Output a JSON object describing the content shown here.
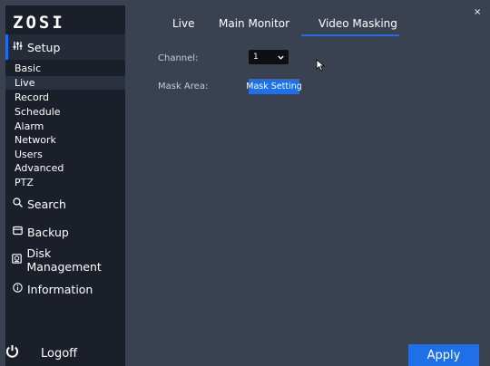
{
  "brand": {
    "logo": "ZOSI"
  },
  "sidebar": {
    "setup": {
      "label": "Setup",
      "icon": "sliders-icon"
    },
    "sub_items": [
      {
        "label": "Basic"
      },
      {
        "label": "Live"
      },
      {
        "label": "Record"
      },
      {
        "label": "Schedule"
      },
      {
        "label": "Alarm"
      },
      {
        "label": "Network"
      },
      {
        "label": "Users"
      },
      {
        "label": "Advanced"
      },
      {
        "label": "PTZ"
      }
    ],
    "active_sub": "Live",
    "search": {
      "label": "Search",
      "icon": "search-icon"
    },
    "backup": {
      "label": "Backup",
      "icon": "backup-icon"
    },
    "disk": {
      "label": "Disk Management",
      "icon": "disk-icon"
    },
    "information": {
      "label": "Information",
      "icon": "info-icon"
    },
    "logoff": {
      "label": "Logoff",
      "icon": "power-icon"
    }
  },
  "tabs": [
    {
      "label": "Live"
    },
    {
      "label": "Main Monitor"
    },
    {
      "label": "Video Masking"
    }
  ],
  "active_tab": "Video Masking",
  "form": {
    "channel_label": "Channel:",
    "channel_value": "1",
    "mask_area_label": "Mask Area:",
    "mask_setting_button": "Mask Setting"
  },
  "close_glyph": "×",
  "apply_label": "Apply",
  "colors": {
    "accent": "#1f6fe8",
    "sidebar_bg": "#1a1f29",
    "main_bg": "#3a4150"
  }
}
